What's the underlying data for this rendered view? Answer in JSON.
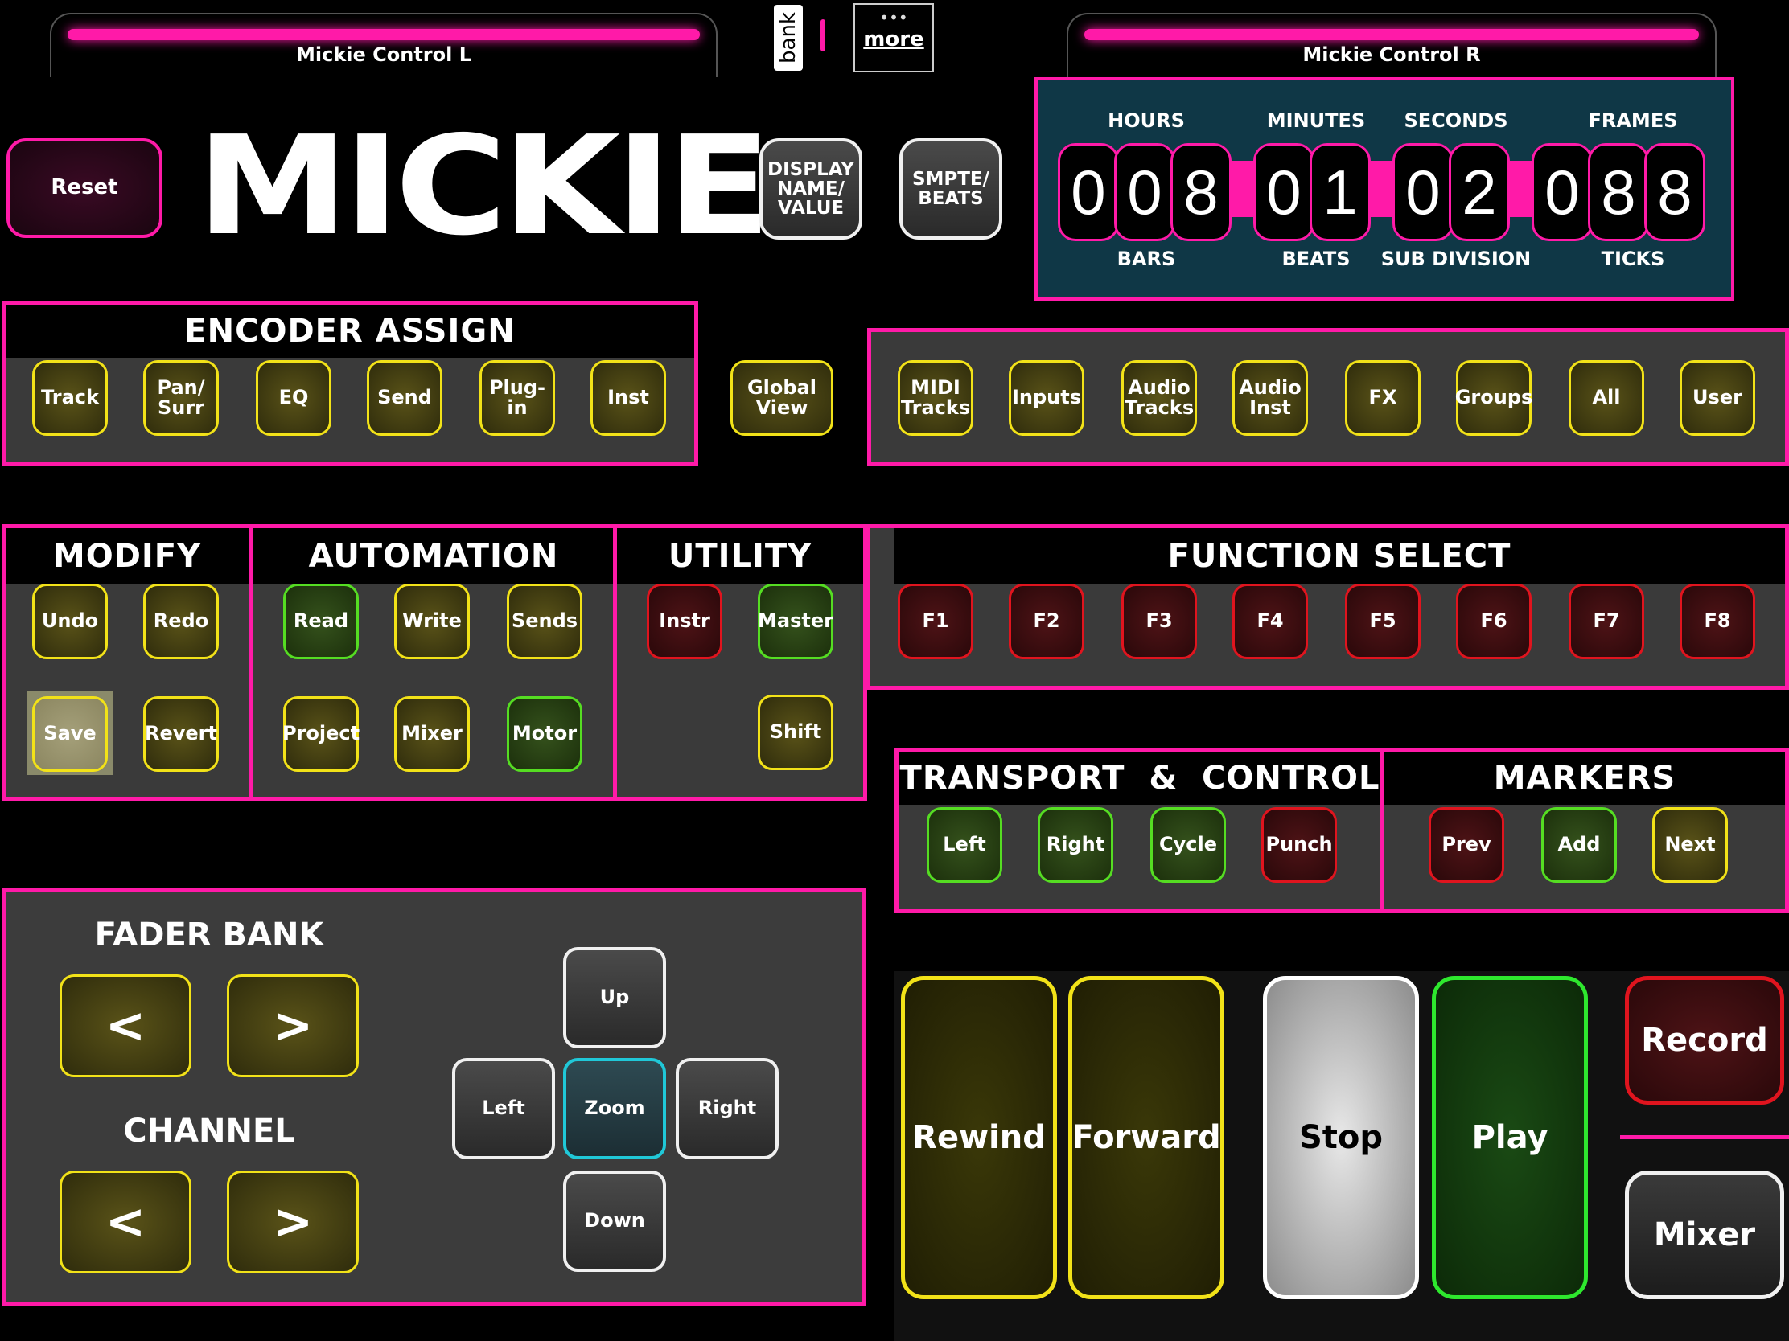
{
  "tabs": {
    "left": "Mickie Control L",
    "right": "Mickie Control R"
  },
  "top": {
    "bank": "bank",
    "more_dots": "•••",
    "more": "more"
  },
  "reset": "Reset",
  "logo": "MICKIE",
  "display_btn": "DISPLAY\nNAME/\nVALUE",
  "smpte_btn": "SMPTE/\nBEATS",
  "timecode": {
    "top_labels": [
      "HOURS",
      "MINUTES",
      "SECONDS",
      "FRAMES"
    ],
    "bottom_labels": [
      "BARS",
      "BEATS",
      "SUB DIVISION",
      "TICKS"
    ],
    "digits": [
      "0",
      "0",
      "8",
      "0",
      "1",
      "0",
      "2",
      "0",
      "8",
      "8"
    ]
  },
  "encoder": {
    "title": "ENCODER ASSIGN",
    "buttons": [
      "Track",
      "Pan/\nSurr",
      "EQ",
      "Send",
      "Plug-\nin",
      "Inst"
    ]
  },
  "global_view": "Global\nView",
  "views": [
    "MIDI\nTracks",
    "Inputs",
    "Audio\nTracks",
    "Audio\nInst",
    "FX",
    "Groups",
    "All",
    "User"
  ],
  "modify": {
    "title": "MODIFY",
    "buttons": [
      "Undo",
      "Redo",
      "Save",
      "Revert"
    ]
  },
  "automation": {
    "title": "AUTOMATION",
    "buttons": [
      "Read",
      "Write",
      "Sends",
      "Project",
      "Mixer",
      "Motor"
    ]
  },
  "utility": {
    "title": "UTILITY",
    "buttons": [
      "Instr",
      "Master",
      "Shift"
    ]
  },
  "function": {
    "title": "FUNCTION SELECT",
    "buttons": [
      "F1",
      "F2",
      "F3",
      "F4",
      "F5",
      "F6",
      "F7",
      "F8"
    ]
  },
  "transport_ctrl": {
    "title": "TRANSPORT  &  CONTROL",
    "buttons": [
      "Left",
      "Right",
      "Cycle",
      "Punch"
    ]
  },
  "markers": {
    "title": "MARKERS",
    "buttons": [
      "Prev",
      "Add",
      "Next"
    ]
  },
  "fader": {
    "bank_title": "FADER BANK",
    "channel_title": "CHANNEL",
    "prev": "<",
    "next": ">"
  },
  "nav": {
    "up": "Up",
    "left": "Left",
    "zoom": "Zoom",
    "right": "Right",
    "down": "Down"
  },
  "transport": {
    "rewind": "Rewind",
    "forward": "Forward",
    "stop": "Stop",
    "play": "Play",
    "record": "Record",
    "mixer": "Mixer"
  },
  "colors": {
    "accent": "#ff1aa8",
    "yellow": "#f2e218",
    "green": "#55dd22",
    "red": "#e0141e",
    "timecode_bg": "#0f3746"
  }
}
